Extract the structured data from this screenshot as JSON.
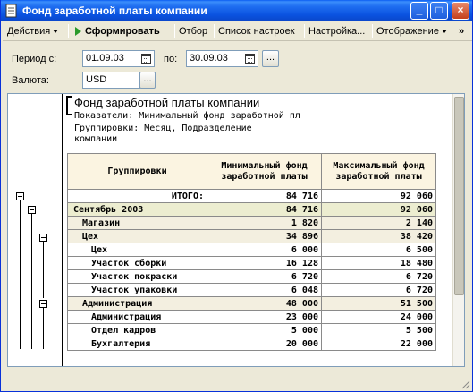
{
  "window": {
    "title": "Фонд заработной платы компании"
  },
  "toolbar": {
    "actions_label": "Действия",
    "generate_label": "Сформировать",
    "filter_label": "Отбор",
    "settings_list_label": "Список настроек",
    "setup_label": "Настройка...",
    "display_label": "Отображение",
    "overflow_label": "»"
  },
  "form": {
    "period_label": "Период с:",
    "period_from": "01.09.03",
    "period_to_label": "по:",
    "period_to": "30.09.03",
    "currency_label": "Валюта:",
    "currency": "USD",
    "ellipsis": "..."
  },
  "report": {
    "title": "Фонд заработной платы компании",
    "indicators": "Показатели:  Минимальный фонд заработной пл",
    "groupings_line1": "Группировки:  Месяц, Подразделение",
    "groupings_line2": "компании",
    "columns": {
      "group": "Группировки",
      "min": "Минимальный фонд заработной платы",
      "max": "Максимальный фонд заработной платы"
    },
    "rows": [
      {
        "name": "ИТОГО:",
        "min": "84 716",
        "max": "92 060",
        "level": "total"
      },
      {
        "name": "Сентябрь 2003",
        "min": "84 716",
        "max": "92 060",
        "level": "lvl0"
      },
      {
        "name": "Магазин",
        "min": "1 820",
        "max": "2 140",
        "level": "lvl1"
      },
      {
        "name": "Цех",
        "min": "34 896",
        "max": "38 420",
        "level": "lvl1"
      },
      {
        "name": "Цех",
        "min": "6 000",
        "max": "6 500",
        "level": "lvl2"
      },
      {
        "name": "Участок сборки",
        "min": "16 128",
        "max": "18 480",
        "level": "lvl2"
      },
      {
        "name": "Участок покраски",
        "min": "6 720",
        "max": "6 720",
        "level": "lvl2"
      },
      {
        "name": "Участок упаковки",
        "min": "6 048",
        "max": "6 720",
        "level": "lvl2"
      },
      {
        "name": "Администрация",
        "min": "48 000",
        "max": "51 500",
        "level": "lvl1"
      },
      {
        "name": "Администрация",
        "min": "23 000",
        "max": "24 000",
        "level": "lvl2"
      },
      {
        "name": "Отдел кадров",
        "min": "5 000",
        "max": "5 500",
        "level": "lvl2"
      },
      {
        "name": "Бухгалтерия",
        "min": "20 000",
        "max": "22 000",
        "level": "lvl2"
      }
    ]
  },
  "colors": {
    "titlebar": "#0a52e0",
    "header_bg": "#fbf4e1",
    "month_row_bg": "#ecedd0",
    "dept_row_bg": "#f3efe0"
  }
}
